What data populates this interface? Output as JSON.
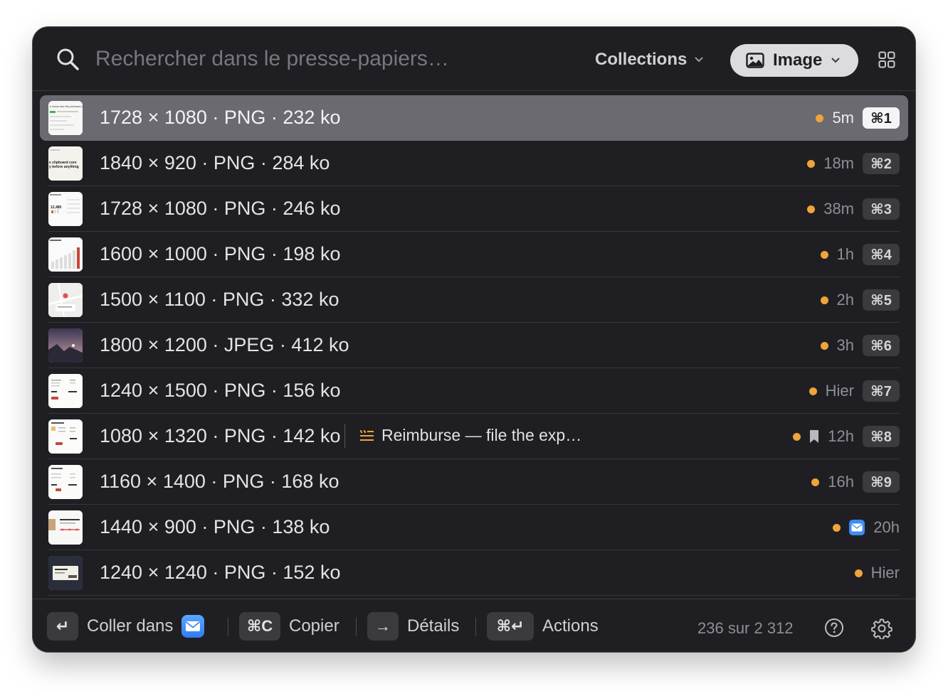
{
  "search": {
    "placeholder": "Rechercher dans le presse-papiers…"
  },
  "header": {
    "collections_label": "Collections",
    "filter_label": "Image"
  },
  "rows": [
    {
      "title": "1728 × 1080 · PNG · 232 ko",
      "age": "5m",
      "shortcut": "⌘1",
      "selected": true,
      "thumb": "doc",
      "thumb_text": "e focus into the previous tab"
    },
    {
      "title": "1840 × 920 · PNG · 284 ko",
      "age": "18m",
      "shortcut": "⌘2",
      "thumb": "text",
      "thumb_text": "e clipboard core / y before anything"
    },
    {
      "title": "1728 × 1080 · PNG · 246 ko",
      "age": "38m",
      "shortcut": "⌘3",
      "thumb": "dashboard",
      "thumb_text": "12,480"
    },
    {
      "title": "1600 × 1000 · PNG · 198 ko",
      "age": "1h",
      "shortcut": "⌘4",
      "thumb": "bars"
    },
    {
      "title": "1500 × 1100 · PNG · 332 ko",
      "age": "2h",
      "shortcut": "⌘5",
      "thumb": "map"
    },
    {
      "title": "1800 × 1200 · JPEG · 412 ko",
      "age": "3h",
      "shortcut": "⌘6",
      "thumb": "photo"
    },
    {
      "title": "1240 × 1500 · PNG · 156 ko",
      "age": "Hier",
      "shortcut": "⌘7",
      "thumb": "receipt"
    },
    {
      "title": "1080 × 1320 · PNG · 142 ko",
      "age": "12h",
      "shortcut": "⌘8",
      "thumb": "receipt2",
      "note": "Reimburse — file the exp…",
      "bookmark": true
    },
    {
      "title": "1160 × 1400 · PNG · 168 ko",
      "age": "16h",
      "shortcut": "⌘9",
      "thumb": "receipt3"
    },
    {
      "title": "1440 × 900 · PNG · 138 ko",
      "age": "20h",
      "shortcut": "",
      "thumb": "order",
      "mail_badge": true
    },
    {
      "title": "1240 × 1240 · PNG · 152 ko",
      "age": "Hier",
      "shortcut": "",
      "thumb": "ticket"
    }
  ],
  "footer": {
    "paste_key": "↵",
    "paste_label": "Coller dans",
    "copy_key": "⌘C",
    "copy_label": "Copier",
    "details_key": "→",
    "details_label": "Détails",
    "actions_key": "⌘↵",
    "actions_label": "Actions",
    "count": "236 sur 2 312"
  },
  "colors": {
    "accent_dot": "#f0a43a",
    "selected_row": "#6a6a70",
    "mail_blue": "#3d8bf2"
  }
}
